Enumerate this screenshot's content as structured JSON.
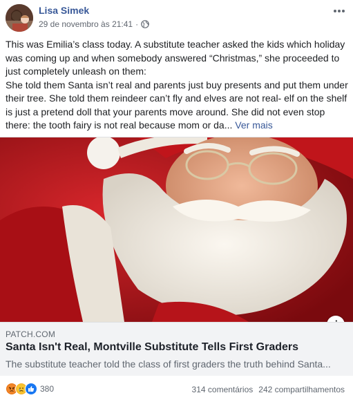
{
  "post": {
    "author": "Lisa Simek",
    "timestamp": "29 de novembro às 21:41",
    "separator": "·",
    "privacy_icon": "globe-icon",
    "text_lines": [
      "This was Emilia’s class today. A substitute teacher asked the kids which holiday was coming up and when somebody answered “Christmas,” she proceeded to just completely unleash on them:",
      "She told them Santa isn’t real and parents just buy presents and put them under their tree. She told them reindeer can’t fly and elves are not real- elf on the shelf is just a pretend doll that your parents move around. She did not even stop there: the tooth fairy is not real because mom or da..."
    ],
    "see_more": "Ver mais"
  },
  "link": {
    "domain": "PATCH.COM",
    "title": "Santa Isn't Real, Montville Substitute Tells First Graders",
    "description": "The substitute teacher told the class of first graders the truth behind Santa...",
    "info_label": "i"
  },
  "footer": {
    "reaction_icons": [
      "angry-icon",
      "sad-icon",
      "like-icon"
    ],
    "reaction_count": "380",
    "comments": "314 comentários",
    "shares": "242 compartilhamentos"
  },
  "colors": {
    "link_blue": "#385898",
    "meta_gray": "#616770",
    "card_bg": "#f2f3f5",
    "santa_red": "#b31217",
    "like_blue": "#1877f2",
    "angry_orange": "#e9710f"
  }
}
